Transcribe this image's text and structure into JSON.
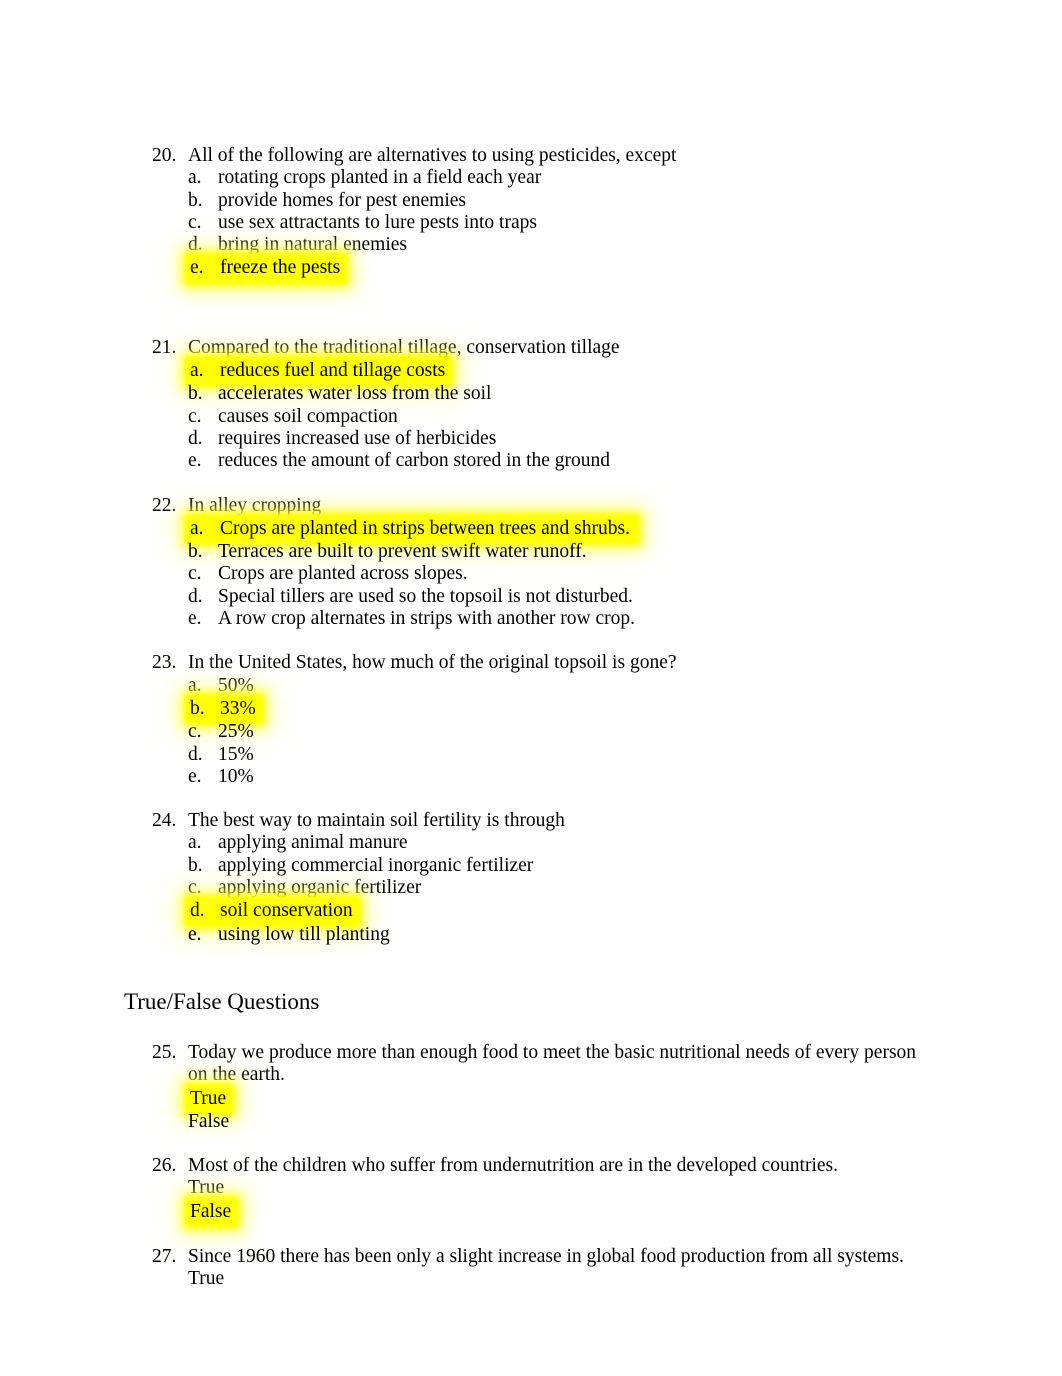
{
  "document": {
    "sections": [
      {
        "type": "questions",
        "items": [
          {
            "number": "20.",
            "stem": "All of the following are alternatives to using pesticides, except",
            "options": [
              {
                "letter": "a.",
                "text": "rotating crops planted in a field each year",
                "highlighted": false
              },
              {
                "letter": "b.",
                "text": "provide homes for pest enemies",
                "highlighted": false
              },
              {
                "letter": "c.",
                "text": "use sex attractants to lure pests into traps",
                "highlighted": false
              },
              {
                "letter": "d.",
                "text": "bring in natural enemies",
                "highlighted": false
              },
              {
                "letter": "e.",
                "text": "freeze the pests",
                "highlighted": true
              }
            ]
          },
          {
            "number": "21.",
            "stem": "Compared to the traditional tillage, conservation tillage",
            "options": [
              {
                "letter": "a.",
                "text": "reduces fuel and tillage costs",
                "highlighted": true
              },
              {
                "letter": "b.",
                "text": "accelerates water loss from the soil",
                "highlighted": false
              },
              {
                "letter": "c.",
                "text": "causes soil compaction",
                "highlighted": false
              },
              {
                "letter": "d.",
                "text": "requires increased use of herbicides",
                "highlighted": false
              },
              {
                "letter": "e.",
                "text": "reduces the amount of carbon stored in the ground",
                "highlighted": false
              }
            ]
          },
          {
            "number": "22.",
            "stem": "In alley cropping",
            "options": [
              {
                "letter": "a.",
                "text": "Crops are planted in strips between trees and shrubs.",
                "highlighted": true
              },
              {
                "letter": "b.",
                "text": "Terraces are built to prevent swift water runoff.",
                "highlighted": false
              },
              {
                "letter": "c.",
                "text": "Crops are planted across slopes.",
                "highlighted": false
              },
              {
                "letter": "d.",
                "text": "Special tillers are used so the topsoil is not disturbed.",
                "highlighted": false
              },
              {
                "letter": "e.",
                "text": "A row crop alternates in strips with another row crop.",
                "highlighted": false
              }
            ]
          },
          {
            "number": "23.",
            "stem": "In the United States, how much of the original topsoil is gone?",
            "options": [
              {
                "letter": "a.",
                "text": "50%",
                "highlighted": false
              },
              {
                "letter": "b.",
                "text": "33%",
                "highlighted": true
              },
              {
                "letter": "c.",
                "text": "25%",
                "highlighted": false
              },
              {
                "letter": "d.",
                "text": "15%",
                "highlighted": false
              },
              {
                "letter": "e.",
                "text": "10%",
                "highlighted": false
              }
            ]
          },
          {
            "number": "24.",
            "stem": "The best way to maintain soil fertility is through",
            "options": [
              {
                "letter": "a.",
                "text": "applying animal manure",
                "highlighted": false
              },
              {
                "letter": "b.",
                "text": "applying commercial inorganic fertilizer",
                "highlighted": false
              },
              {
                "letter": "c.",
                "text": "applying organic fertilizer",
                "highlighted": false
              },
              {
                "letter": "d.",
                "text": "soil conservation",
                "highlighted": true
              },
              {
                "letter": "e.",
                "text": "using low till planting",
                "highlighted": false
              }
            ]
          }
        ]
      },
      {
        "type": "heading",
        "title": "True/False Questions"
      },
      {
        "type": "truefalse",
        "items": [
          {
            "number": "25.",
            "stem": "Today we produce more than enough food to meet the basic nutritional needs of every person on the earth.",
            "choices": [
              {
                "text": "True",
                "highlighted": true
              },
              {
                "text": "False",
                "highlighted": false
              }
            ]
          },
          {
            "number": "26.",
            "stem": "Most of the children who suffer from undernutrition are in the developed countries.",
            "choices": [
              {
                "text": "True",
                "highlighted": false
              },
              {
                "text": "False",
                "highlighted": true
              }
            ]
          },
          {
            "number": "27.",
            "stem": "Since 1960 there has been only a slight increase in global food production from all systems.",
            "choices": [
              {
                "text": "True",
                "highlighted": false
              }
            ]
          }
        ]
      }
    ]
  },
  "colors": {
    "highlight": "#ffff00",
    "text": "#000000",
    "page_background": "#ffffff"
  }
}
